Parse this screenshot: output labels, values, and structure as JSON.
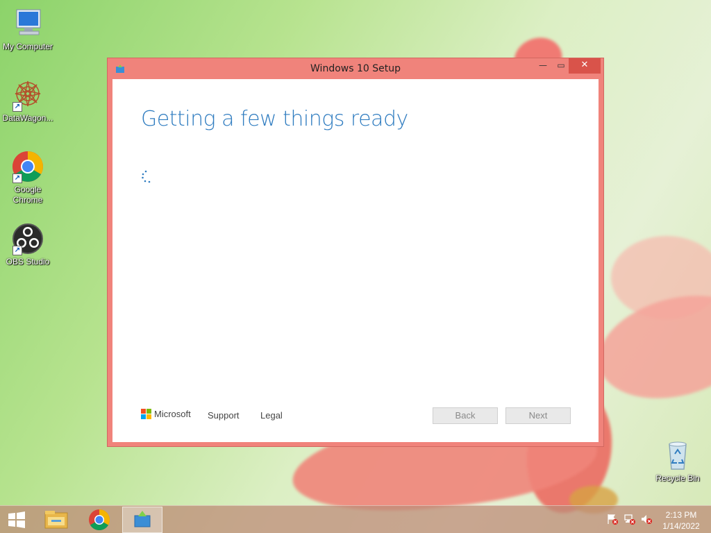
{
  "desktop": {
    "icons": [
      {
        "label": "My Computer",
        "icon": "computer-icon"
      },
      {
        "label": "DataWagon...",
        "icon": "datawagon-icon"
      },
      {
        "label": "Google\nChrome",
        "icon": "chrome-icon"
      },
      {
        "label": "OBS Studio",
        "icon": "obs-icon"
      },
      {
        "label": "Recycle Bin",
        "icon": "recycle-bin-icon"
      }
    ]
  },
  "window": {
    "title": "Windows 10 Setup",
    "heading": "Getting a few things ready",
    "footer": {
      "brand": "Microsoft",
      "support_label": "Support",
      "legal_label": "Legal",
      "back_label": "Back",
      "next_label": "Next"
    },
    "colors": {
      "frame": "#f0837b",
      "heading": "#2f7cc0"
    }
  },
  "taskbar": {
    "items": [
      "start-icon",
      "file-explorer-icon",
      "chrome-icon",
      "windows-setup-icon"
    ],
    "clock": {
      "time": "2:13 PM",
      "date": "1/14/2022"
    }
  }
}
